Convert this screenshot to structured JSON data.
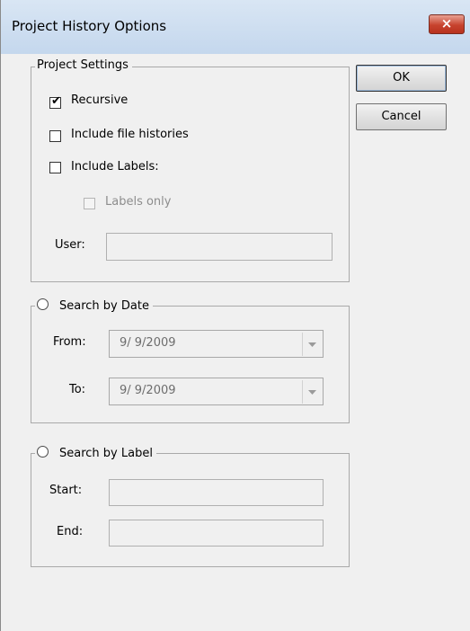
{
  "window": {
    "title": "Project History Options",
    "close_glyph": "×"
  },
  "project_settings": {
    "legend": "Project Settings",
    "recursive": {
      "label": "Recursive",
      "checked": true
    },
    "include_file_histories": {
      "label": "Include file histories",
      "checked": false
    },
    "include_labels": {
      "label": "Include Labels:",
      "checked": false
    },
    "labels_only": {
      "label": "Labels only",
      "checked": false,
      "enabled": false
    },
    "user": {
      "label": "User:",
      "value": ""
    }
  },
  "search_by_date": {
    "legend": "Search by Date",
    "selected": false,
    "from": {
      "label": "From:",
      "value": "9/ 9/2009"
    },
    "to": {
      "label": "To:",
      "value": "9/ 9/2009"
    }
  },
  "search_by_label": {
    "legend": "Search by Label",
    "selected": false,
    "start": {
      "label": "Start:",
      "value": ""
    },
    "end": {
      "label": "End:",
      "value": ""
    }
  },
  "buttons": {
    "ok": "OK",
    "cancel": "Cancel"
  },
  "icons": {
    "check": "✔",
    "close": "close-icon",
    "dropdown": "chevron-down-icon"
  }
}
